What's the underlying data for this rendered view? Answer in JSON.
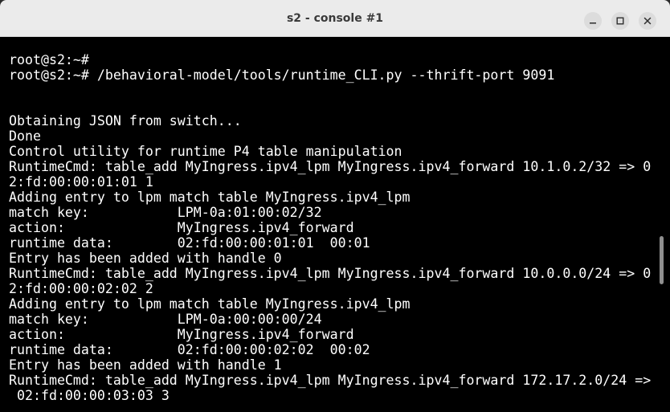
{
  "window": {
    "title": "s2 - console #1"
  },
  "controls": {
    "minimize_icon": "minimize-icon",
    "maximize_icon": "maximize-icon",
    "close_icon": "close-icon"
  },
  "terminal": {
    "lines": [
      "",
      "root@s2:~#",
      "root@s2:~# /behavioral-model/tools/runtime_CLI.py --thrift-port 9091",
      "",
      "",
      "Obtaining JSON from switch...",
      "Done",
      "Control utility for runtime P4 table manipulation",
      "RuntimeCmd: table_add MyIngress.ipv4_lpm MyIngress.ipv4_forward 10.1.0.2/32 => 0",
      "2:fd:00:00:01:01 1",
      "Adding entry to lpm match table MyIngress.ipv4_lpm",
      "match key:           LPM-0a:01:00:02/32",
      "action:              MyIngress.ipv4_forward",
      "runtime data:        02:fd:00:00:01:01  00:01",
      "Entry has been added with handle 0",
      "RuntimeCmd: table_add MyIngress.ipv4_lpm MyIngress.ipv4_forward 10.0.0.0/24 => 0",
      "2:fd:00:00:02:02 2",
      "Adding entry to lpm match table MyIngress.ipv4_lpm",
      "match key:           LPM-0a:00:00:00/24",
      "action:              MyIngress.ipv4_forward",
      "runtime data:        02:fd:00:00:02:02  00:02",
      "Entry has been added with handle 1",
      "RuntimeCmd: table_add MyIngress.ipv4_lpm MyIngress.ipv4_forward 172.17.2.0/24 =>",
      " 02:fd:00:00:03:03 3"
    ]
  },
  "colors": {
    "terminal_background": "#000000",
    "terminal_foreground": "#ffffff",
    "titlebar_background": "#ebebeb"
  }
}
